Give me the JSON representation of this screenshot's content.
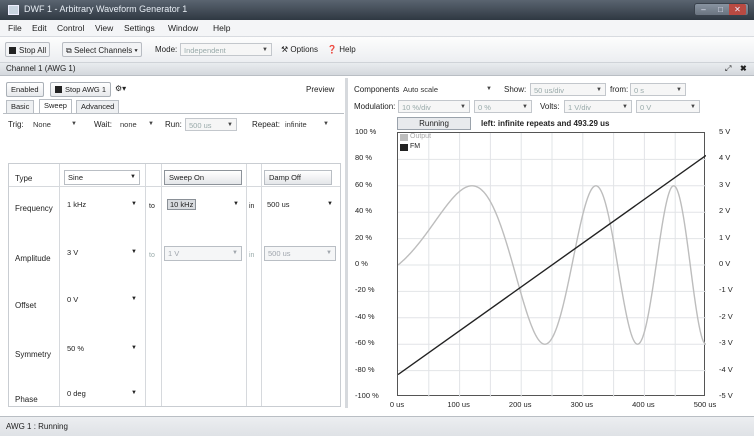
{
  "window": {
    "title": "DWF 1 - Arbitrary Waveform Generator 1"
  },
  "menu": [
    "File",
    "Edit",
    "Control",
    "View",
    "Settings",
    "Window",
    "Help"
  ],
  "toolbar": {
    "stop_all": "Stop All",
    "select_channels": "Select Channels",
    "mode_label": "Mode:",
    "mode_value": "Independent",
    "options": "Options",
    "help": "Help"
  },
  "channel_header": "Channel 1 (AWG 1)",
  "left": {
    "enabled": "Enabled",
    "stop_awg": "Stop AWG 1",
    "preview": "Preview",
    "tabs": [
      "Basic",
      "Sweep",
      "Advanced"
    ],
    "active_tab": "Sweep",
    "trig_label": "Trig:",
    "trig_value": "None",
    "wait_label": "Wait:",
    "wait_value": "none",
    "run_label": "Run:",
    "run_value": "500 us",
    "repeat_label": "Repeat:",
    "repeat_value": "infinite",
    "rows": [
      {
        "label": "Type",
        "value": "Sine",
        "sweep": "Sweep On",
        "damp": "Damp Off"
      },
      {
        "label": "Frequency",
        "value": "1 kHz",
        "to": "to",
        "to_value": "10 kHz",
        "in": "in",
        "in_value": "500 us"
      },
      {
        "label": "Amplitude",
        "value": "3 V",
        "to": "to",
        "to_value": "1 V",
        "in": "in",
        "in_value": "500 us"
      },
      {
        "label": "Offset",
        "value": "0 V"
      },
      {
        "label": "Symmetry",
        "value": "50 %"
      },
      {
        "label": "Phase",
        "value": "0 deg"
      }
    ]
  },
  "right": {
    "components_label": "Components:",
    "components_value": "Auto scale",
    "show_label": "Show:",
    "show_value": "50 us/div",
    "from_label": "from:",
    "from_value": "0 s",
    "modulation_label": "Modulation:",
    "modulation_value": "10 %/div",
    "modulation_offset": "0 %",
    "volts_label": "Volts:",
    "volts_value": "1 V/div",
    "volts_offset": "0 V",
    "running": "Running",
    "run_info": "left: infinite repeats and 493.29 us",
    "legend": [
      {
        "name": "Output",
        "color": "#bdbdbd"
      },
      {
        "name": "FM",
        "color": "#222222"
      }
    ]
  },
  "chart_data": {
    "type": "line",
    "y_left_ticks": [
      "100 %",
      "80 %",
      "60 %",
      "40 %",
      "20 %",
      "0 %",
      "-20 %",
      "-40 %",
      "-60 %",
      "-80 %",
      "-100 %"
    ],
    "y_right_ticks": [
      "5 V",
      "4 V",
      "3 V",
      "2 V",
      "1 V",
      "0 V",
      "-1 V",
      "-2 V",
      "-3 V",
      "-4 V",
      "-5 V"
    ],
    "x_ticks": [
      "0 us",
      "100 us",
      "200 us",
      "300 us",
      "400 us",
      "500 us"
    ],
    "x_range_us": [
      0,
      500
    ],
    "y_left_range_pct": [
      -100,
      100
    ],
    "y_right_range_v": [
      -5,
      5
    ],
    "series": [
      {
        "name": "Output",
        "color": "#bdbdbd",
        "freq_start_khz": 1,
        "freq_end_khz": 10,
        "amplitude_v": 3,
        "offset_v": 0
      },
      {
        "name": "FM",
        "color": "#222222",
        "x": [
          0,
          500
        ],
        "y_pct": [
          -83,
          83
        ]
      }
    ],
    "grid": true
  },
  "status": "AWG 1 : Running"
}
